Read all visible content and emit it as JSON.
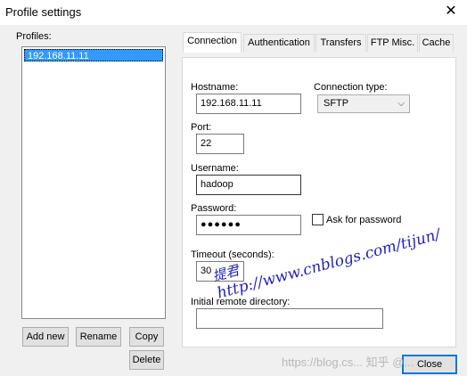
{
  "window": {
    "title": "Profile settings",
    "close_glyph": "✕"
  },
  "profiles": {
    "label": "Profiles:",
    "items": [
      "192.168.11.11"
    ],
    "buttons": {
      "add_new": "Add new",
      "rename": "Rename",
      "copy": "Copy",
      "delete": "Delete"
    }
  },
  "tabs": [
    "Connection",
    "Authentication",
    "Transfers",
    "FTP Misc.",
    "Cache"
  ],
  "connection": {
    "hostname_label": "Hostname:",
    "hostname_value": "192.168.11.11",
    "connection_type_label": "Connection type:",
    "connection_type_value": "SFTP",
    "port_label": "Port:",
    "port_value": "22",
    "username_label": "Username:",
    "username_value": "hadoop",
    "password_label": "Password:",
    "password_value": "●●●●●●",
    "ask_password_label": "Ask for password",
    "ask_password_checked": false,
    "timeout_label": "Timeout (seconds):",
    "timeout_value": "30",
    "remote_dir_label": "Initial remote directory:",
    "remote_dir_value": ""
  },
  "footer": {
    "close": "Close"
  },
  "watermarks": {
    "name": "提君",
    "url": "http://www.cnblogs.com/tijun/",
    "zhihu": "https://blog.cs... 知乎 @..."
  },
  "colors": {
    "selection": "#3399ff",
    "dialog_bg": "#f0f0f0",
    "watermark": "#2222bb"
  }
}
